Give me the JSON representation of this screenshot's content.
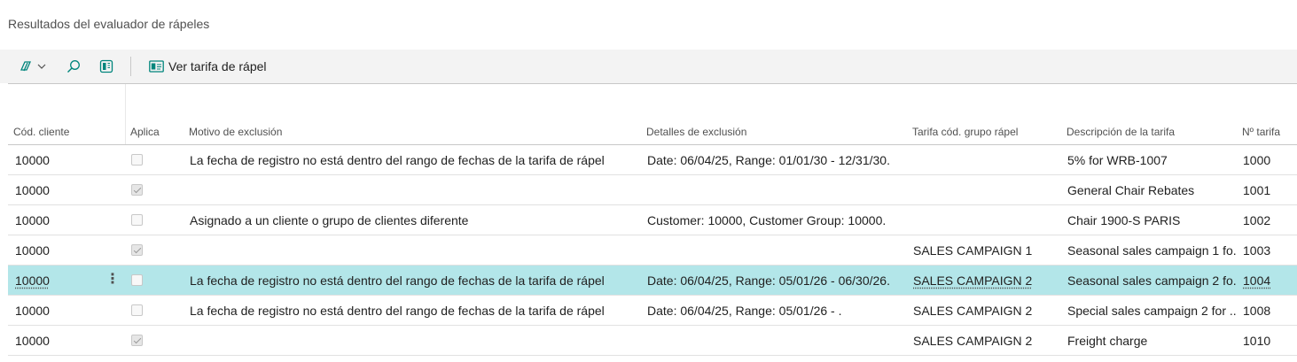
{
  "page": {
    "title": "Resultados del evaluador de rápeles"
  },
  "actions": {
    "view_tariff_label": "Ver tarifa de rápel"
  },
  "columns": [
    "Cód. cliente",
    "Aplica",
    "Motivo de exclusión",
    "Detalles de exclusión",
    "Tarifa cód. grupo rápel",
    "Descripción de la tarifa",
    "Nº tarifa"
  ],
  "rows": [
    {
      "customer": "10000",
      "applies": false,
      "reason": "La fecha de registro no está dentro del rango de fechas de la tarifa de rápel",
      "details": "Date: 06/04/25, Range: 01/01/30 - 12/31/30.",
      "group": "",
      "description": "5% for WRB-1007",
      "tariff_no": "1000",
      "selected": false
    },
    {
      "customer": "10000",
      "applies": true,
      "reason": "",
      "details": "",
      "group": "",
      "description": "General Chair Rebates",
      "tariff_no": "1001",
      "selected": false
    },
    {
      "customer": "10000",
      "applies": false,
      "reason": "Asignado a un cliente o grupo de clientes diferente",
      "details": "Customer: 10000, Customer Group: 10000.",
      "group": "",
      "description": "Chair 1900-S PARIS",
      "tariff_no": "1002",
      "selected": false
    },
    {
      "customer": "10000",
      "applies": true,
      "reason": "",
      "details": "",
      "group": "SALES CAMPAIGN 1",
      "description": "Seasonal sales campaign 1 fo...",
      "tariff_no": "1003",
      "selected": false
    },
    {
      "customer": "10000",
      "applies": false,
      "reason": "La fecha de registro no está dentro del rango de fechas de la tarifa de rápel",
      "details": "Date: 06/04/25, Range: 05/01/26 - 06/30/26.",
      "group": "SALES CAMPAIGN 2",
      "description": "Seasonal sales campaign 2 fo...",
      "tariff_no": "1004",
      "selected": true
    },
    {
      "customer": "10000",
      "applies": false,
      "reason": "La fecha de registro no está dentro del rango de fechas de la tarifa de rápel",
      "details": "Date: 06/04/25, Range: 05/01/26 - .",
      "group": "SALES CAMPAIGN 2",
      "description": "Special sales campaign 2 for ...",
      "tariff_no": "1008",
      "selected": false
    },
    {
      "customer": "10000",
      "applies": true,
      "reason": "",
      "details": "",
      "group": "SALES CAMPAIGN 2",
      "description": "Freight charge",
      "tariff_no": "1010",
      "selected": false
    }
  ],
  "colors": {
    "selected_row": "#b3e6e9",
    "accent": "#00857c"
  }
}
